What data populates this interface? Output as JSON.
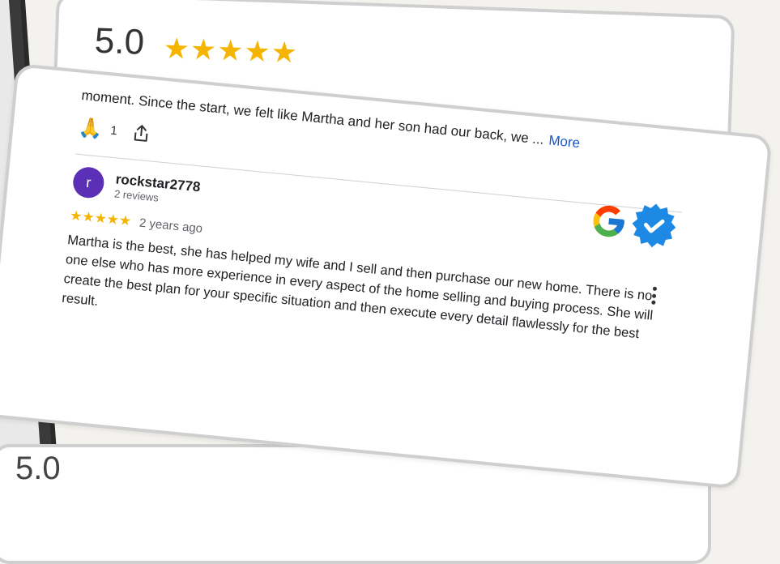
{
  "background_card": {
    "rating": "5.0"
  },
  "header_card": {
    "rating": "5.0",
    "stars": "★★★★★"
  },
  "previous_review": {
    "excerpt": "moment. Since the start, we felt like Martha and her son had our back, we ...",
    "more_label": "More",
    "reaction_icon": "folded-hands-emoji",
    "reaction_emoji": "🙏",
    "reaction_count": "1",
    "share_icon": "share-icon"
  },
  "review": {
    "avatar_letter": "r",
    "avatar_color": "#5b2fb6",
    "reviewer_name": "rockstar2778",
    "reviewer_review_count": "2 reviews",
    "stars": "★★★★★",
    "time_ago": "2 years ago",
    "body": "Martha is the best, she has helped my wife and I sell and then purchase our new home. There is no one else who has more experience in every aspect of the home selling and buying process. She will create the best plan for your specific situation and then execute every detail flawlessly for the best result.",
    "source_icon": "google-logo-icon",
    "verified_icon": "verified-badge-icon"
  },
  "colors": {
    "star": "#f4b400",
    "link": "#1a56c7",
    "verified": "#1e88e5"
  }
}
